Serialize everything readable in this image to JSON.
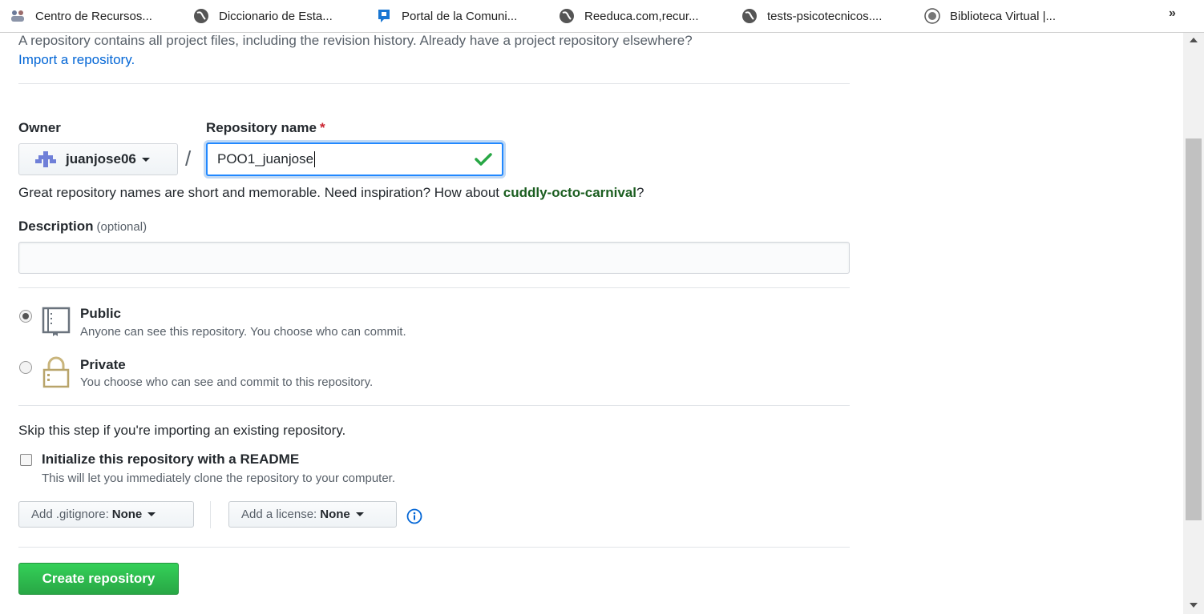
{
  "bookmarks": {
    "items": [
      {
        "label": "Centro de Recursos...",
        "icon": "people-icon"
      },
      {
        "label": "Diccionario de Esta...",
        "icon": "globe-icon"
      },
      {
        "label": "Portal de la Comuni...",
        "icon": "portal-icon"
      },
      {
        "label": "Reeduca.com,recur...",
        "icon": "globe-icon"
      },
      {
        "label": "tests-psicotecnicos....",
        "icon": "globe-icon"
      },
      {
        "label": "Biblioteca Virtual |...",
        "icon": "library-icon"
      }
    ],
    "more": "»"
  },
  "intro": {
    "text": "A repository contains all project files, including the revision history. Already have a project repository elsewhere?",
    "link": "Import a repository."
  },
  "owner": {
    "label": "Owner",
    "value": "juanjose06"
  },
  "repo_name": {
    "label": "Repository name",
    "required_mark": "*",
    "value": "POO1_juanjose",
    "separator": "/"
  },
  "hint": {
    "text": "Great repository names are short and memorable. Need inspiration? How about ",
    "suggestion": "cuddly-octo-carnival",
    "end": "?"
  },
  "description": {
    "label": "Description",
    "optional": "(optional)",
    "value": ""
  },
  "visibility": {
    "public": {
      "title": "Public",
      "desc": "Anyone can see this repository. You choose who can commit.",
      "checked": true
    },
    "private": {
      "title": "Private",
      "desc": "You choose who can see and commit to this repository.",
      "checked": false
    }
  },
  "init": {
    "skip_text": "Skip this step if you're importing an existing repository.",
    "label": "Initialize this repository with a README",
    "desc": "This will let you immediately clone the repository to your computer.",
    "checked": false
  },
  "gitignore": {
    "label": "Add .gitignore:",
    "value": "None"
  },
  "license": {
    "label": "Add a license:",
    "value": "None"
  },
  "create_button": "Create repository",
  "colors": {
    "primary_button": "#28a745",
    "link": "#0366d6",
    "focus": "#2188ff",
    "required": "#cb2431"
  }
}
